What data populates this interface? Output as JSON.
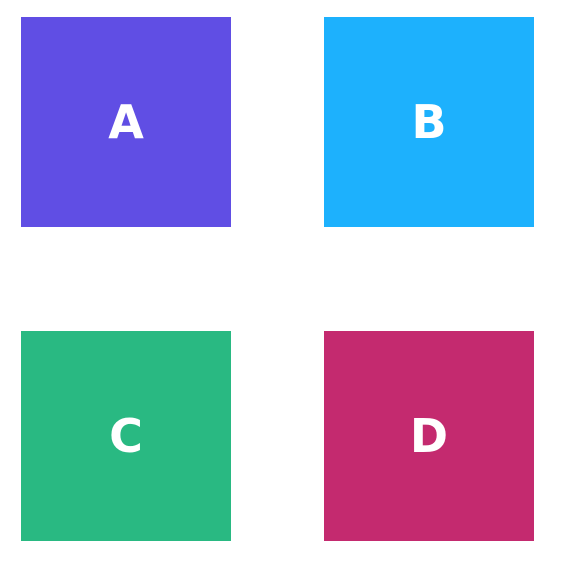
{
  "tiles": [
    {
      "label": "A",
      "color": "#604ee4"
    },
    {
      "label": "B",
      "color": "#1db1fd"
    },
    {
      "label": "C",
      "color": "#29b982"
    },
    {
      "label": "D",
      "color": "#c42a6f"
    }
  ]
}
